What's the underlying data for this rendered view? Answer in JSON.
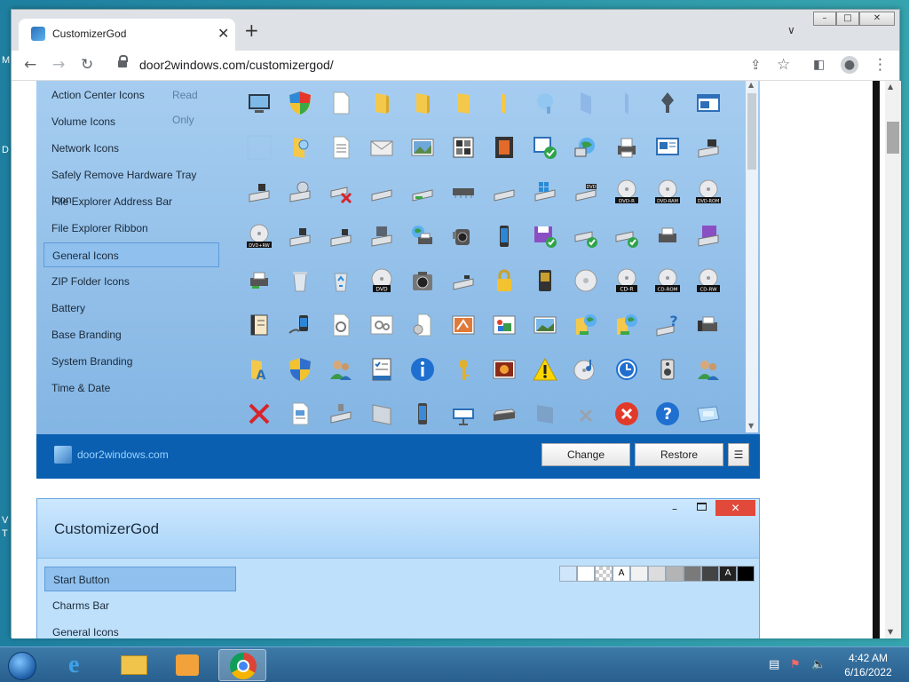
{
  "browser": {
    "tab_title": "CustomizerGod",
    "url": "door2windows.com/customizergod/",
    "new_tab": "+",
    "tab_close": "✕"
  },
  "app1": {
    "sidebar": [
      {
        "label": "Action Center Icons",
        "active": false
      },
      {
        "label": "Volume Icons",
        "active": false
      },
      {
        "label": "Network Icons",
        "active": false
      },
      {
        "label": "Safely Remove Hardware Tray Icon",
        "active": false
      },
      {
        "label": "File Explorer Address Bar",
        "active": false
      },
      {
        "label": "File Explorer Ribbon",
        "active": false
      },
      {
        "label": "General Icons",
        "active": true
      },
      {
        "label": "ZIP Folder Icons",
        "active": false
      },
      {
        "label": "Battery",
        "active": false
      },
      {
        "label": "Base Branding",
        "active": false
      },
      {
        "label": "System Branding",
        "active": false
      },
      {
        "label": "Time & Date",
        "active": false
      }
    ],
    "read_only_label": "Read Only",
    "footer_brand": "door2windows.com",
    "change_label": "Change",
    "restore_label": "Restore",
    "menu_label": "☰",
    "icon_labels": {
      "dvd": "DVD",
      "dvd_r": "DVD-R",
      "dvd_ram": "DVD-RAM",
      "dvd_rom": "DVD-ROM",
      "dvd_rw": "DVD+RW",
      "cd_r": "CD-R",
      "cd_rom": "CD-ROM",
      "cd_rw": "CD-RW"
    }
  },
  "app2": {
    "title": "CustomizerGod",
    "min": "–",
    "close": "✕",
    "sidebar": [
      {
        "label": "Start Button",
        "active": true
      },
      {
        "label": "Charms Bar",
        "active": false
      },
      {
        "label": "General Icons",
        "active": false
      }
    ],
    "swatch_label_a": "A",
    "swatch_label_b": "A"
  },
  "taskbar": {
    "time": "4:42 AM",
    "date": "6/16/2022"
  }
}
